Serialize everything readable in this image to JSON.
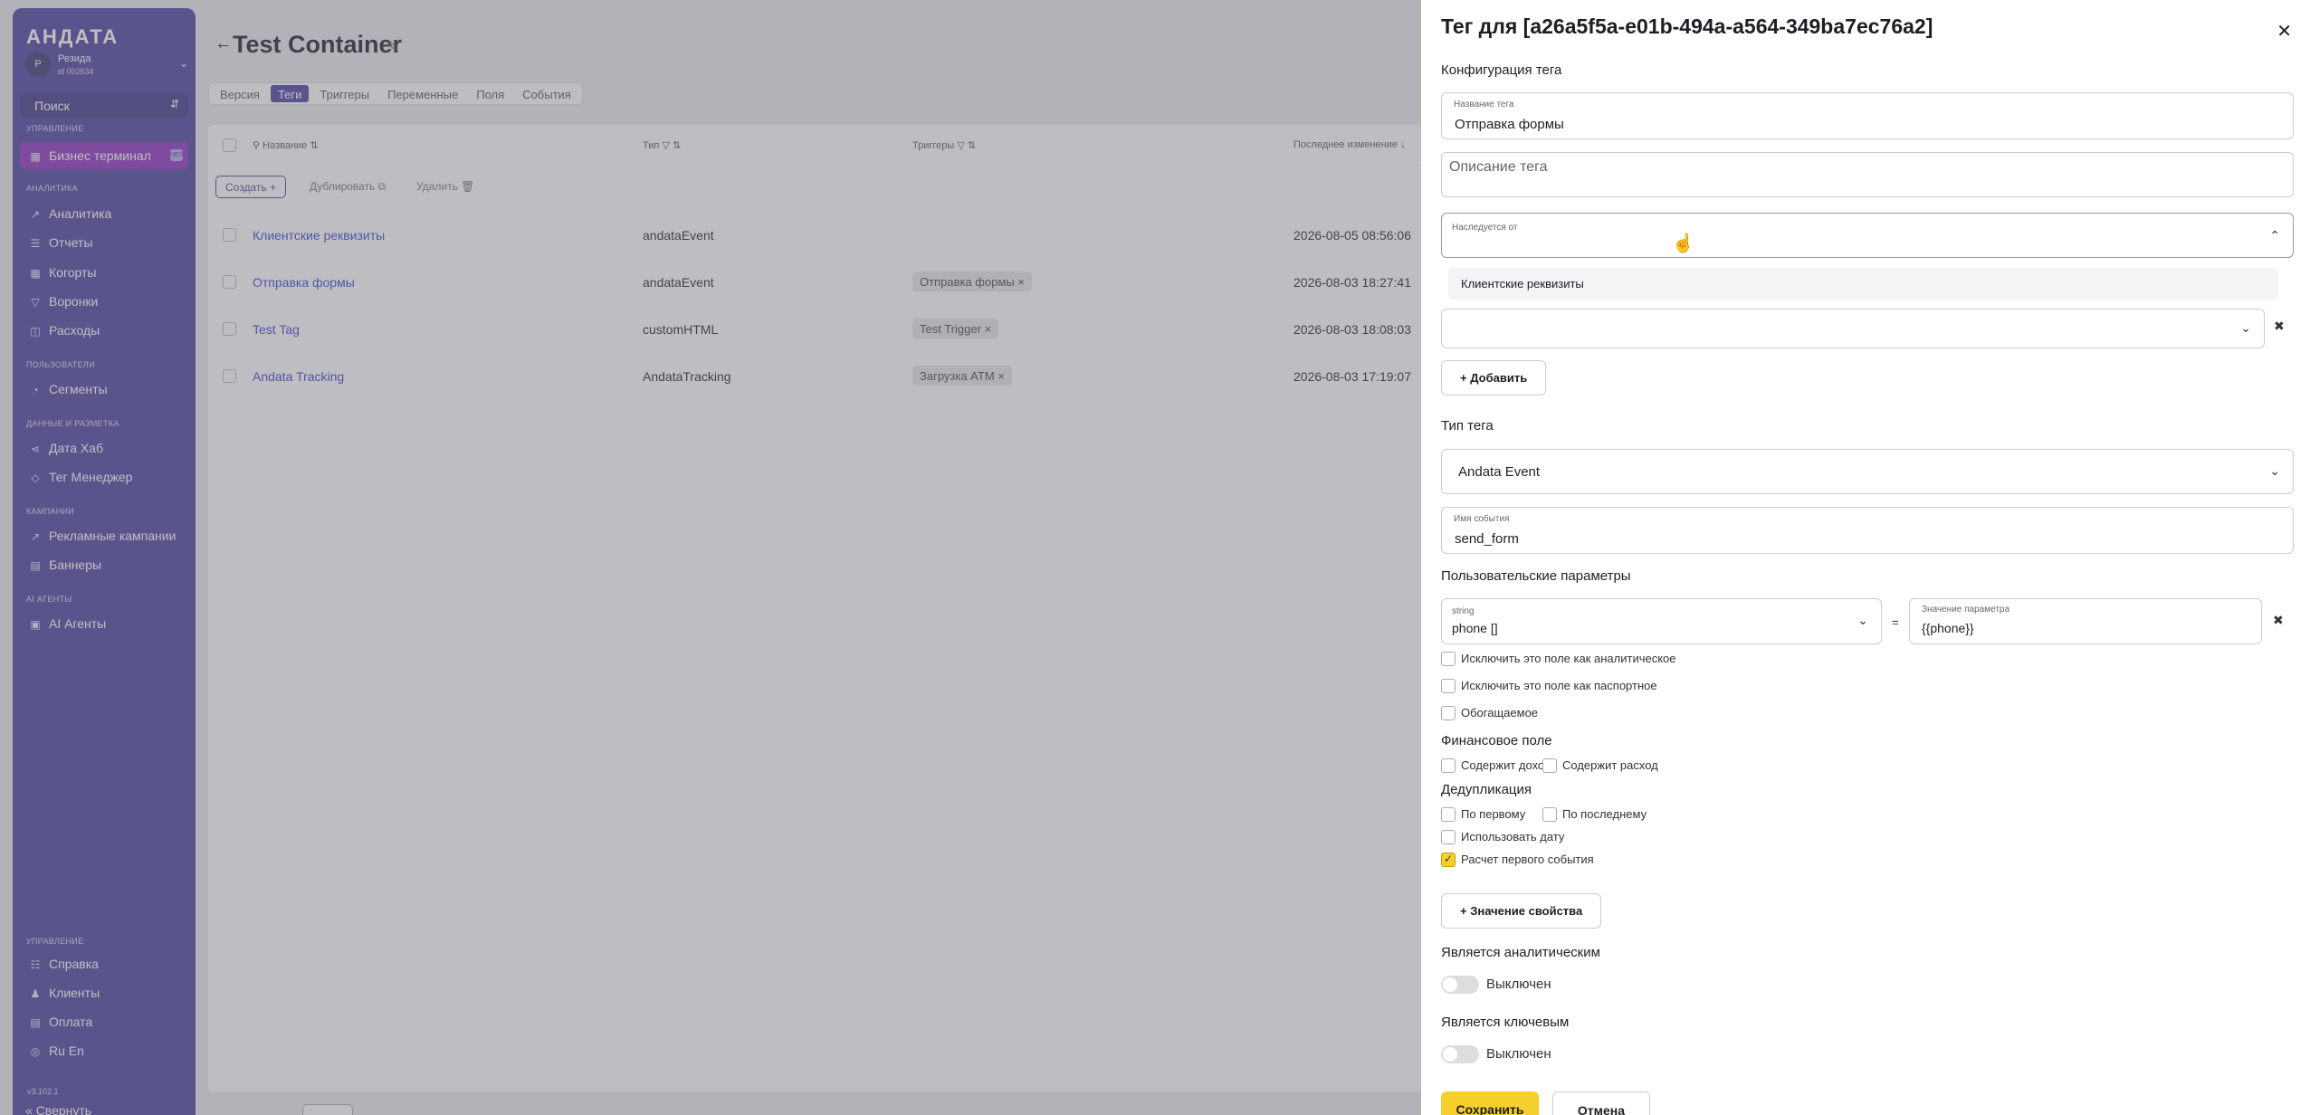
{
  "sidebar": {
    "logo": "АНДАТА",
    "user": {
      "initial": "Р",
      "name": "Резида",
      "id": "id 002634"
    },
    "search": "Поиск",
    "sections": {
      "management": "Управление",
      "analytics": "Аналитика",
      "users": "Пользователи",
      "data": "Данные и разметка",
      "campaigns": "Кампании",
      "ai": "AI Агенты",
      "control": "Управление"
    },
    "items": {
      "terminal": "Бизнес терминал",
      "analytics": "Аналитика",
      "reports": "Отчеты",
      "cohorts": "Когорты",
      "funnels": "Воронки",
      "expenses": "Расходы",
      "segments": "Сегменты",
      "datahub": "Дата Хаб",
      "tagmanager": "Тег Менеджер",
      "adcampaigns": "Рекламные кампании",
      "banners": "Баннеры",
      "aiagents": "AI Агенты",
      "help": "Справка",
      "clients": "Клиенты",
      "payment": "Оплата",
      "lang": "Ru En"
    },
    "terminal_badge": "NEW",
    "version": "v3.102.1",
    "collapse": "Свернуть"
  },
  "main": {
    "title": "Test Container",
    "tabs": [
      "Версия",
      "Теги",
      "Триггеры",
      "Переменные",
      "Поля",
      "События"
    ],
    "headers": {
      "name": "Название",
      "type": "Тип",
      "triggers": "Триггеры",
      "modified": "Последнее изменение"
    },
    "actions": {
      "create": "Создать",
      "duplicate": "Дублировать",
      "delete": "Удалить"
    },
    "rows": [
      {
        "name": "Клиентские реквизиты",
        "type": "andataEvent",
        "trigger": "",
        "date": "2026-08-05 08:56:06"
      },
      {
        "name": "Отправка формы",
        "type": "andataEvent",
        "trigger": "Отправка формы",
        "date": "2026-08-03 18:27:41"
      },
      {
        "name": "Test Tag",
        "type": "customHTML",
        "trigger": "Test Trigger",
        "date": "2026-08-03 18:08:03"
      },
      {
        "name": "Andata Tracking",
        "type": "AndataTracking",
        "trigger": "Загрузка ATM",
        "date": "2026-08-03 17:19:07"
      }
    ]
  },
  "panel": {
    "title": "Тег для [a26a5f5a-e01b-494a-a564-349ba7ec76a2]",
    "config_label": "Конфигурация тега",
    "name_label": "Название тега",
    "name_value": "Отправка формы",
    "desc_placeholder": "Описание тега",
    "inherit_label": "Наследуется от",
    "inherit_option": "Клиентские реквизиты",
    "add_label": "Добавить",
    "type_label": "Тип тега",
    "type_value": "Andata Event",
    "event_label": "Имя события",
    "event_value": "send_form",
    "params_label": "Пользовательские параметры",
    "param_type": "string",
    "param_name": "phone []",
    "param_eq": "=",
    "param_value_label": "Значение параметра",
    "param_value": "{{phone}}",
    "checks": {
      "exclude_analytic": "Исключить это поле как аналитическое",
      "exclude_passport": "Исключить это поле как паспортное",
      "enriched": "Обогащаемое"
    },
    "finance_label": "Финансовое поле",
    "income": "Содержит доход",
    "expense": "Содержит расход",
    "dedup_label": "Дедупликация",
    "first": "По первому",
    "last": "По последнему",
    "use_date": "Использовать дату",
    "first_event": "Расчет первого события",
    "property_value": "Значение свойства",
    "is_analytic": "Является аналитическим",
    "is_analytic_state": "Выключен",
    "is_key": "Является ключевым",
    "is_key_state": "Выключен",
    "save": "Сохранить",
    "cancel": "Отмена"
  }
}
